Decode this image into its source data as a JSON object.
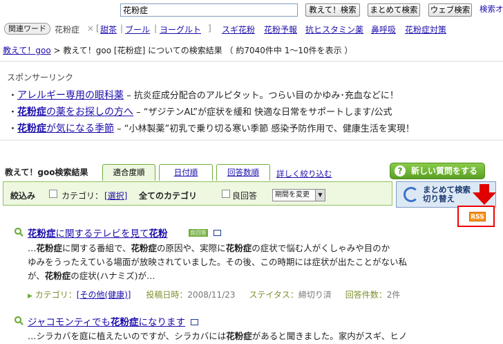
{
  "topbar": {
    "search_value": "花粉症",
    "btn_oshiete": "教えて！検索",
    "btn_matomete": "まとめて検索",
    "btn_web": "ウェブ検索",
    "right_link": "検索オ"
  },
  "related": {
    "label": "関連ワード",
    "current_word": "花粉症",
    "remove": "×",
    "bracket_open": "[",
    "bracket_close": "]",
    "words_in_bracket": [
      "甜茶",
      "ブール",
      "ヨーグルト"
    ],
    "words": [
      "スギ花粉",
      "花粉予報",
      "抗ヒスタミン薬",
      "鼻呼吸",
      "花粉症対策"
    ]
  },
  "breadcrumb": {
    "home": "教えて！goo",
    "text": "> 教えて！goo [花粉症] についての検索結果 （ 約7040件中 1～10件を表示 ）"
  },
  "sponsor": {
    "title": "スポンサーリンク",
    "ads": [
      {
        "bullet": "・",
        "link": "アレルギー専用の眼科薬",
        "desc": " – 抗炎症成分配合のアルピタット。つらい目のかゆみ･充血などに！"
      },
      {
        "bullet": "・",
        "link_bold": "花粉症",
        "link": "の薬をお探しの方へ",
        "desc": " – “ザジテンAL”が症状を緩和 快適な日常をサポートします/公式"
      },
      {
        "bullet": "・",
        "link_bold": "花粉症",
        "link": "が気になる季節",
        "desc": " – “小林製薬”初乳で乗り切る寒い季節 感染予防作用で、健康生活を実現！"
      }
    ]
  },
  "results_header": {
    "title": "教えて！goo検索結果",
    "tabs": [
      "適合度順",
      "日付順",
      "回答数順"
    ],
    "refine": "詳しく絞り込む",
    "new_question": "新しい質問をする"
  },
  "filter": {
    "label": "絞込み",
    "category_label": "カテゴリ：",
    "category_select": "[選択]",
    "category_value": "全てのカテゴリ",
    "good_answer": "良回答",
    "period": "期間を変更"
  },
  "switch": {
    "line1": "まとめて検索",
    "line2": "切り替え"
  },
  "rss": {
    "label": "RSS"
  },
  "results": [
    {
      "title_bold": "花粉症",
      "title_mid": "に関するテレビを見て",
      "title_bold2": "花粉",
      "tag": "良回答",
      "snippet": [
        "…花粉症に関する番組で、花粉症の原因や、実際に花粉症の症状で悩む人がくしゃみや目のか",
        "ゆみをうったえている場面が放映されていました。その後、この時期には症状が出たことがない私",
        "が、花粉症の症状(ハナミズ)が…"
      ],
      "meta": {
        "category_key": "カテゴリ：",
        "category_value": "[その他(健康)]",
        "date_key": "投稿日時：",
        "date_value": "2008/11/23",
        "status_key": "ステイタス：",
        "status_value": "締切り済",
        "answers_key": "回答件数：",
        "answers_value": "2件"
      }
    },
    {
      "title_mid": "ジャコモンティでも",
      "title_bold": "花粉症",
      "title_end": "になります",
      "snippet": [
        "…シラカバを庭に植えたいのですが、シラカバには花粉症があると聞きました。家内がスギ、ヒノ"
      ]
    }
  ],
  "colors": {
    "link": "#1a0dab",
    "green": "#6fae3c",
    "filter_bg": "#eef7e0",
    "rss_orange": "#f7931e",
    "arrow_red": "#e00000"
  }
}
